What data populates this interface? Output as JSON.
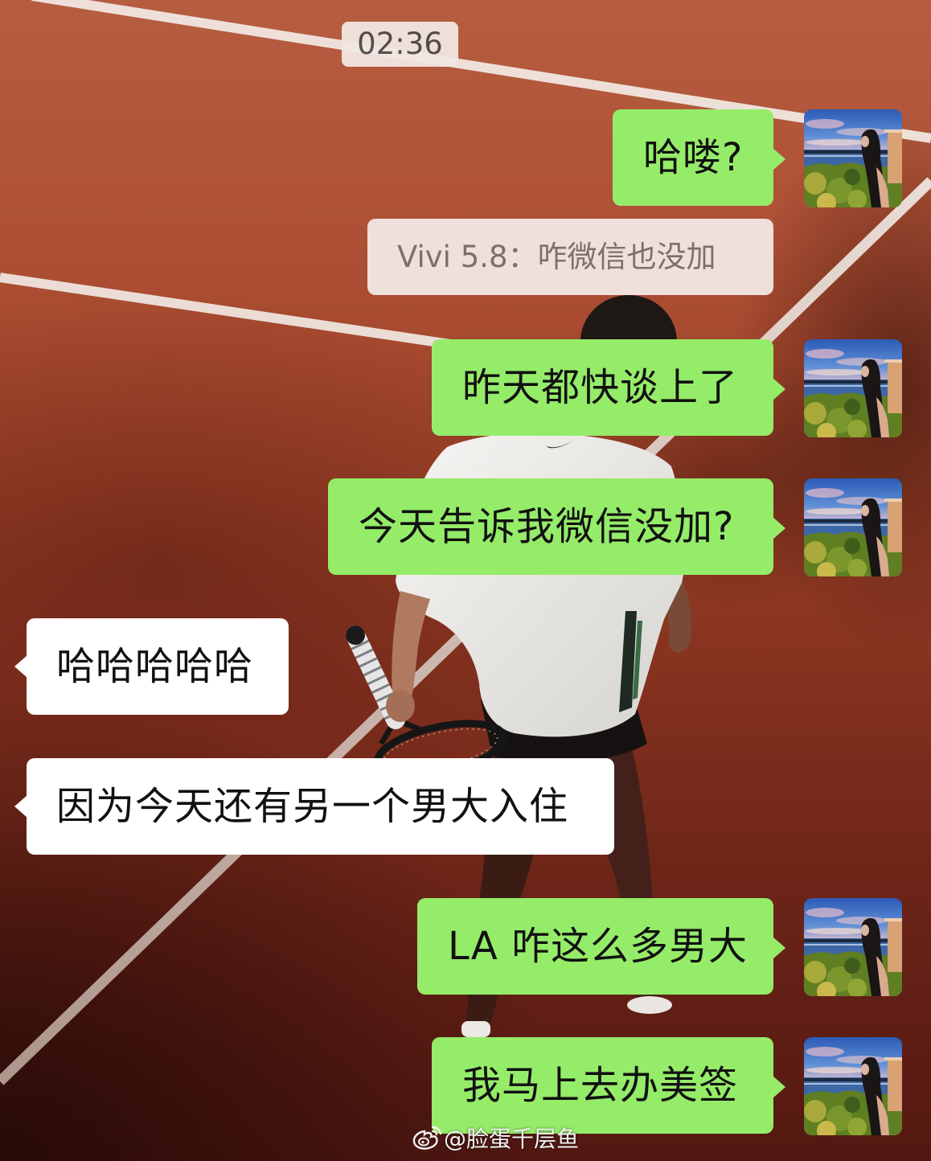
{
  "status": {
    "timestamp": "02:36"
  },
  "messages": [
    {
      "outgoing": true,
      "is_quote": false,
      "text": "哈喽?",
      "avatar_icon": "avatar-photo"
    },
    {
      "outgoing": true,
      "is_quote": true,
      "text": "Vivi 5.8：咋微信也没加"
    },
    {
      "outgoing": true,
      "is_quote": false,
      "text": "昨天都快谈上了",
      "avatar_icon": "avatar-photo"
    },
    {
      "outgoing": true,
      "is_quote": false,
      "text": "今天告诉我微信没加?",
      "avatar_icon": "avatar-photo"
    },
    {
      "outgoing": false,
      "is_quote": false,
      "text": "哈哈哈哈哈"
    },
    {
      "outgoing": false,
      "is_quote": false,
      "text": "因为今天还有另一个男大入住"
    },
    {
      "outgoing": true,
      "is_quote": false,
      "text": "LA 咋这么多男大",
      "avatar_icon": "avatar-photo"
    },
    {
      "outgoing": true,
      "is_quote": false,
      "text": "我马上去办美签",
      "avatar_icon": "avatar-photo"
    }
  ],
  "watermark": {
    "icon": "weibo-icon",
    "text": "@脸蛋千层鱼"
  },
  "colors": {
    "outgoing_bubble": "#95EC69",
    "incoming_bubble": "#FFFFFF",
    "quote_bubble": "#F3E6E2",
    "quote_text": "#7E716D",
    "timestamp_bg": "#F2E8E2",
    "timestamp_text": "#4B4B4B",
    "message_text": "#111111",
    "watermark_text": "#F5F5F5"
  }
}
